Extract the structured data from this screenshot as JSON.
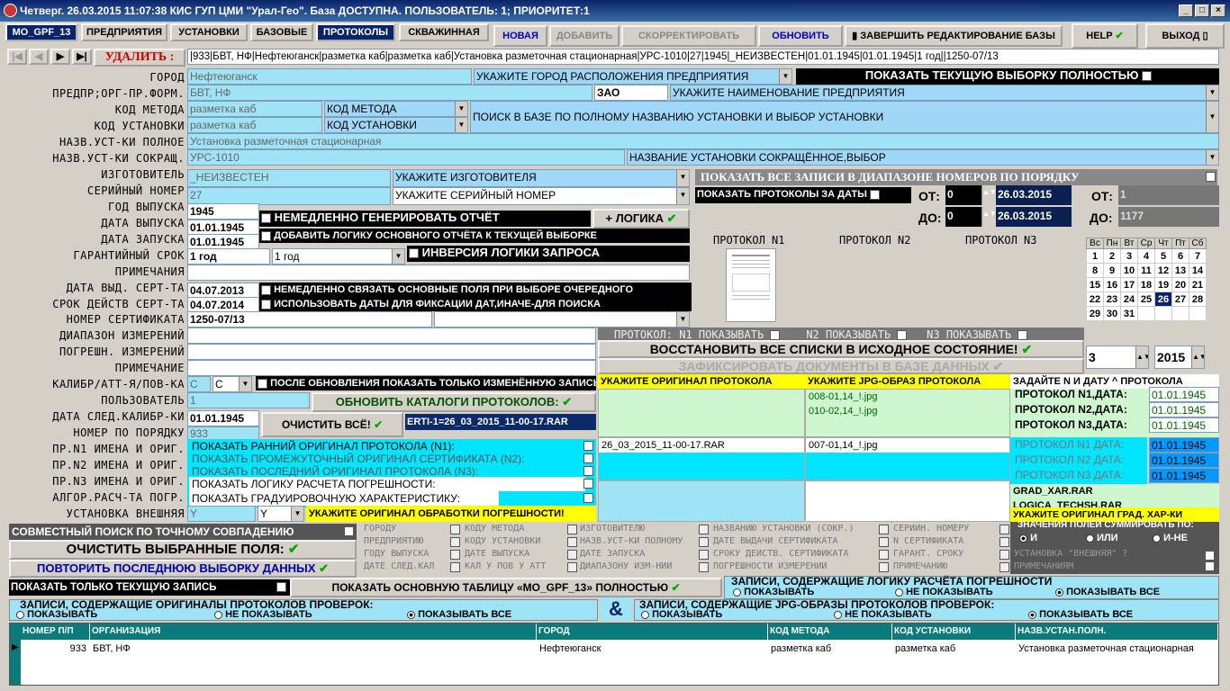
{
  "window": {
    "title": "Четверг. 26.03.2015 11:07:38 КИС ГУП ЦМИ \"Урал-Гео\". База ДОСТУПНА. ПОЛЬЗОВАТЕЛЬ: 1; ПРИОРИТЕТ:1"
  },
  "tabs": [
    "MO_GPF_13",
    "ПРЕДПРИЯТИЯ",
    "УСТАНОВКИ",
    "БАЗОВЫЕ",
    "ПРОТОКОЛЫ",
    "СКВАЖИННАЯ"
  ],
  "toolbar": {
    "new": "НОВАЯ",
    "add": "ДОБАВИТЬ",
    "correct": "СКОРРЕКТИРОВАТЬ",
    "refresh": "ОБНОВИТЬ",
    "finish": "ЗАВЕРШИТЬ РЕДАКТИРОВАНИЕ БАЗЫ",
    "help": "HELP",
    "exit": "ВЫХОД"
  },
  "nav": {
    "delete": "УДАЛИТЬ :",
    "record": "|933|БВТ, НФ|Нефтеюганск|разметка каб|разметка каб|Установка разметочная стационарная|УРС-1010|27|1945|_НЕИЗВЕСТЕН|01.01.1945|01.01.1945|1 год||1250-07/13"
  },
  "labels": {
    "city": "ГОРОД",
    "enterprise": "ПРЕДПР;ОРГ-ПР.ФОРМ.",
    "method_code": "КОД МЕТОДА",
    "install_code": "КОД УСТАНОВКИ",
    "full_name": "НАЗВ.УСТ-КИ ПОЛНОЕ",
    "short_name": "НАЗВ.УСТ-КИ СОКРАЩ.",
    "maker": "ИЗГОТОВИТЕЛЬ",
    "serial": "СЕРИЙНЫЙ НОМЕР",
    "year": "ГОД ВЫПУСКА",
    "release_date": "ДАТА ВЫПУСКА",
    "start_date": "ДАТА ЗАПУСКА",
    "warranty": "ГАРАНТИЙНЫЙ СРОК",
    "notes": "ПРИМЕЧАНИЯ",
    "cert_date": "ДАТА ВЫД. СЕРТ-ТА",
    "cert_valid": "СРОК ДЕЙСТВ СЕРТ-ТА",
    "cert_no": "НОМЕР СЕРТИФИКАТА",
    "range": "ДИАПАЗОН ИЗМЕРЕНИЙ",
    "error": "ПОГРЕШН. ИЗМЕРЕНИЙ",
    "note2": "ПРИМЕЧАНИЕ",
    "calib": "КАЛИБР/АТТ-Я/ПОВ-КА",
    "user": "ПОЛЬЗОВАТЕЛЬ",
    "next_calib": "ДАТА СЛЕД.КАЛИБР-КИ",
    "order_no": "НОМЕР ПО ПОРЯДКУ",
    "pr1": "ПР.N1 ИМЕНА И ОРИГ.",
    "pr2": "ПР.N2 ИМЕНА И ОРИГ.",
    "pr3": "ПР.N3 ИМЕНА И ОРИГ.",
    "algo": "АЛГОР.РАСЧ-ТА ПОГР.",
    "external": "УСТАНОВКА ВНЕШНЯЯ"
  },
  "values": {
    "city": "Нефтеюганск",
    "enterprise": "БВТ, НФ",
    "form": "ЗАО",
    "method_code": "разметка каб",
    "install_code": "разметка каб",
    "full_name": "Установка разметочная стационарная",
    "short_name": "УРС-1010",
    "maker": "_НЕИЗВЕСТЕН",
    "serial": "27",
    "year": "1945",
    "release_date": "01.01.1945",
    "start_date": "01.01.1945",
    "warranty": "1 год",
    "warranty2": "1 год",
    "cert_date": "04.07.2013",
    "cert_valid": "04.07.2014",
    "cert_no": "1250-07/13",
    "calib": "C",
    "calib2": "C",
    "user": "1",
    "next_calib": "01.01.1945",
    "order_no": "933",
    "external": "Y",
    "external2": "Y"
  },
  "hints": {
    "city": "УКАЖИТЕ ГОРОД РАСПОЛОЖЕНИЯ ПРЕДПРИЯТИЯ",
    "show_selection": "ПОКАЗАТЬ ТЕКУЩУЮ ВЫБОРКУ ПОЛНОСТЬЮ",
    "enterprise": "УКАЖИТЕ НАИМЕНОВАНИЕ ПРЕДПРИЯТИЯ",
    "method_combo": "КОД МЕТОДА",
    "install_combo": "КОД УСТАНОВКИ",
    "search": "ПОИСК В БАЗЕ ПО ПОЛНОМУ НАЗВАНИЮ УСТАНОВКИ И ВЫБОР УСТАНОВКИ",
    "short_combo": "НАЗВАНИЕ УСТАНОВКИ СОКРАЩЁННОЕ,ВЫБОР",
    "maker": "УКАЖИТЕ ИЗГОТОВИТЕЛЯ",
    "serial": "УКАЖИТЕ СЕРИЙНЫЙ НОМЕР",
    "show_range": "ПОКАЗАТЬ ВСЕ ЗАПИСИ В ДИАПАЗОНЕ НОМЕРОВ ПО ПОРЯДКУ",
    "show_dates": "ПОКАЗАТЬ ПРОТОКОЛЫ ЗА ДАТЫ",
    "gen_report": "НЕМЕДЛЕННО ГЕНЕРИРОВАТЬ ОТЧЁТ",
    "logic": "+ ЛОГИКА",
    "add_logic": "ДОБАВИТЬ ЛОГИКУ ОСНОВНОГО ОТЧЁТА К ТЕКУЩЕЙ ВЫБОРКЕ",
    "inverse": "ИНВЕРСИЯ ЛОГИКИ ЗАПРОСА",
    "link_fields": "НЕМЕДЛЕННО СВЯЗАТЬ ОСНОВНЫЕ ПОЛЯ ПРИ ВЫБОРЕ ОЧЕРЕДНОГО",
    "use_dates": "ИСПОЛЬЗОВАТЬ ДАТЫ ДЛЯ ФИКСАЦИИ ДАТ,ИНАЧЕ-ДЛЯ ПОИСКА",
    "after_update": "ПОСЛЕ ОБНОВЛЕНИЯ ПОКАЗАТЬ ТОЛЬКО ИЗМЕНЁННУЮ ЗАПИСЬ",
    "update_catalogs": "ОБНОВИТЬ КАТАЛОГИ ПРОТОКОЛОВ:",
    "clear_all": "ОЧИСТИТЬ ВСЁ!",
    "archive": "ERTI-1=26_03_2015_11-00-17.RAR",
    "orig1": "ПОКАЗАТЬ РАННИЙ ОРИГИНАЛ ПРОТОКОЛА (N1):",
    "orig2": "ПОКАЗАТЬ ПРОМЕЖУТОЧНЫЙ ОРИГИНАЛ СЕРТИФИКАТА (N2):",
    "orig3": "ПОКАЗАТЬ ПОСЛЕДНИЙ ОРИГИНАЛ ПРОТОКОЛА (N3):",
    "logic_calc": "ПОКАЗАТЬ ЛОГИКУ РАСЧЕТА ПОГРЕШНОСТИ:",
    "grad": "ПОКАЗАТЬ ГРАДУИРОВОЧНУЮ ХАРАКТЕРИСТИКУ:",
    "orig_proc": "УКАЖИТЕ ОРИГИНАЛ ОБРАБОТКИ ПОГРЕШНОСТИ!"
  },
  "right": {
    "from": "ОТ:",
    "to": "ДО:",
    "from_val": "0",
    "to_val": "0",
    "date_from": "26.03.2015",
    "date_to": "26.03.2015",
    "num_from": "1",
    "num_to": "1177",
    "proto1": "ПРОТОКОЛ N1",
    "proto2": "ПРОТОКОЛ N2",
    "proto3": "ПРОТОКОЛ N3",
    "show1": "ПРОТОКОЛ: N1 ПОКАЗЫВАТЬ",
    "show2": "N2 ПОКАЗЫВАТЬ",
    "show3": "N3 ПОКАЗЫВАТЬ",
    "restore": "ВОССТАНОВИТЬ ВСЕ СПИСКИ В ИСХОДНОЕ СОСТОЯНИЕ!",
    "fix": "ЗАФИКСИРОВАТЬ ДОКУМЕНТЫ В БАЗЕ ДАННЫХ",
    "month": "3",
    "year": "2015",
    "hdr_orig": "УКАЖИТЕ ОРИГИНАЛ ПРОТОКОЛА",
    "hdr_jpg": "УКАЖИТЕ JPG-ОБРАЗ ПРОТОКОЛА",
    "hdr_date": "ЗАДАЙТЕ N И ДАТУ ^ ПРОТОКОЛА",
    "jpg1": "008-01,14_!.jpg",
    "jpg2": "010-02,14_!.jpg",
    "rar": "26_03_2015_11-00-17.RAR",
    "jpg3": "007-01,14_!.jpg",
    "pd1": "ПРОТОКОЛ N1,ДАТА:",
    "pd2": "ПРОТОКОЛ N2,ДАТА:",
    "pd3": "ПРОТОКОЛ N3,ДАТА:",
    "pdv1": "01.01.1945",
    "pdv2": "01.01.1945",
    "pdv3": "01.01.1945",
    "pg1": "ПРОТОКОЛ N1 ДАТА:",
    "pg2": "ПРОТОКОЛ N2 ДАТА:",
    "pg3": "ПРОТОКОЛ N3 ДАТА:",
    "pgv1": "01.01.1945",
    "pgv2": "01.01.1945",
    "pgv3": "01.01.1945",
    "grad1": "GRAD_XAR.RAR",
    "grad2": "LOGICA_TECHSH.RAR",
    "grad_hint": "УКАЖИТЕ ОРИГИНАЛ ГРАД. ХАР-КИ"
  },
  "calendar": {
    "days": [
      "Вс",
      "Пн",
      "Вт",
      "Ср",
      "Чт",
      "Пт",
      "Сб"
    ],
    "weeks": [
      [
        "1",
        "2",
        "3",
        "4",
        "5",
        "6",
        "7"
      ],
      [
        "8",
        "9",
        "10",
        "11",
        "12",
        "13",
        "14"
      ],
      [
        "15",
        "16",
        "17",
        "18",
        "19",
        "20",
        "21"
      ],
      [
        "22",
        "23",
        "24",
        "25",
        "26",
        "27",
        "28"
      ],
      [
        "29",
        "30",
        "31",
        "",
        "",
        "",
        ""
      ]
    ],
    "selected": "26"
  },
  "bottom": {
    "joint": "СОВМЕСТНЫЙ ПОИСК ПО ТОЧНОМУ СОВПАДЕНИЮ",
    "clear_sel": "ОЧИСТИТЬ ВЫБРАННЫЕ ПОЛЯ:",
    "repeat": "ПОВТОРИТЬ ПОСЛЕДНЮЮ ВЫБОРКУ ДАННЫХ",
    "only_current": "ПОКАЗАТЬ ТОЛЬКО ТЕКУЩУЮ ЗАПИСЬ",
    "main_table": "ПОКАЗАТЬ ОСНОВНУЮ ТАБЛИЦУ «MO_GPF_13» ПОЛНОСТЬЮ",
    "sum_hdr": "ЗНАЧЕНИЯ ПОЛЕЙ СУММИРОВАТЬ ПО:",
    "and": "И",
    "or": "ИЛИ",
    "nor": "И-НЕ",
    "ext": "УСТАНОВКА \"ВНЕШНЯЯ\" ?",
    "notes": "ПРИМЕЧАНИЯМ",
    "logic_hdr": "ЗАПИСИ, СОДЕРЖАЩИЕ ЛОГИКУ РАСЧЁТА ПОГРЕШНОСТИ",
    "orig_hdr": "ЗАПИСИ, СОДЕРЖАЩИЕ ОРИГИНАЛЫ ПРОТОКОЛОВ ПРОВЕРОК:",
    "jpg_hdr": "ЗАПИСИ, СОДЕРЖАЩИЕ JPG-ОБРАЗЫ ПРОТОКОЛОВ ПРОВЕРОК:",
    "show": "ПОКАЗЫВАТЬ",
    "noshow": "НЕ ПОКАЗЫВАТЬ",
    "showall": "ПОКАЗЫВАТЬ ВСЕ",
    "amp": "&"
  },
  "groups": [
    [
      "ГОРОДУ",
      "КОДУ МЕТОДА",
      "ИЗГОТОВИТЕЛЮ",
      "НАЗВАНИЮ УСТАНОВКИ (СОКР.)",
      "СЕРИЙН. НОМЕРУ"
    ],
    [
      "ПРЕДПРИЯТИЮ",
      "КОДУ УСТАНОВКИ",
      "НАЗВ.УСТ-КИ ПОЛНОМУ",
      "ДАТЕ ВЫДАЧИ СЕРТИФИКАТА",
      "N СЕРТИФИКАТА"
    ],
    [
      "ГОДУ ВЫПУСКА",
      "ДАТЕ ВЫПУСКА",
      "ДАТЕ ЗАПУСКА",
      "СРОКУ ДЕЙСТВ. СЕРТИФИКАТА",
      "ГАРАНТ. СРОКУ"
    ],
    [
      "ДАТЕ СЛЕД.КАЛ",
      "КАЛ У ПОВ У АТТ",
      "ДИАПАЗОНУ ИЗМ-НИЙ",
      "ПОГРЕШНОСТИ ИЗМЕРЕНИЙ",
      "ПРИМЕЧАНИЮ"
    ]
  ],
  "grid": {
    "headers": [
      "НОМЕР П/П",
      "ОРГАНИЗАЦИЯ",
      "ГОРОД",
      "КОД МЕТОДА",
      "КОД УСТАНОВКИ",
      "НАЗВ.УСТАН.ПОЛН."
    ],
    "row": [
      "933",
      "БВТ, НФ",
      "Нефтеюганск",
      "разметка каб",
      "разметка каб",
      "Установка разметочная стационарная"
    ]
  }
}
